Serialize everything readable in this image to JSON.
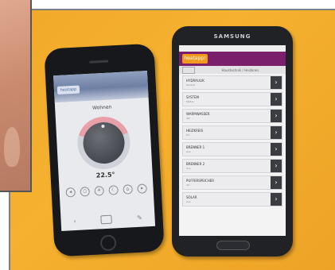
{
  "samsung_phone": {
    "brand": "SAMSUNG",
    "app_badge": "heatapp!",
    "subheader": "Haustechnik / Heizkreis",
    "list_rows": [
      {
        "label": "HYDRAULIK",
        "sub": "Zentral"
      },
      {
        "label": "SYSTEM",
        "sub": "Status"
      },
      {
        "label": "WARMWASSER",
        "sub": "48°"
      },
      {
        "label": "HEIZKREIS",
        "sub": "Ein"
      },
      {
        "label": "BRENNER 1",
        "sub": "Aus"
      },
      {
        "label": "BRENNER 2",
        "sub": "Aus"
      },
      {
        "label": "PUFFERSPEICHER",
        "sub": "41°"
      },
      {
        "label": "SOLAR",
        "sub": "Aus"
      }
    ]
  },
  "iphone": {
    "logo_text": "heatapp",
    "room_title": "Wohnen",
    "temperature": "22.5°"
  }
}
